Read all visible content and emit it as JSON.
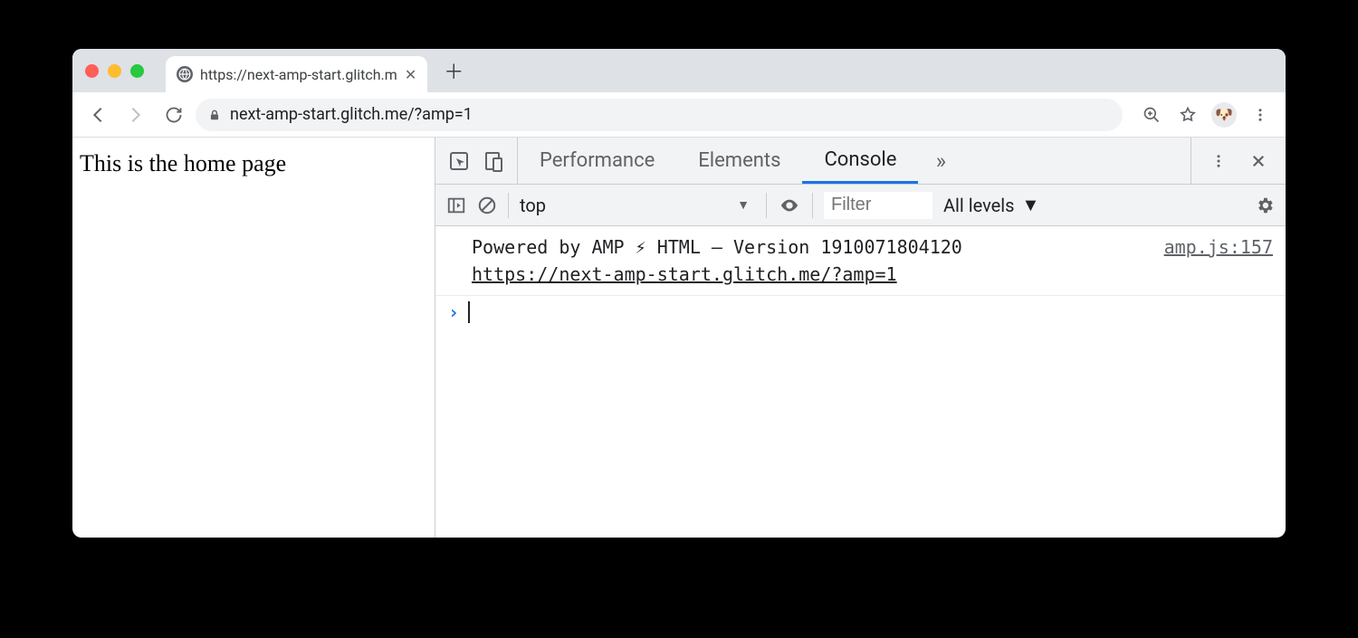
{
  "browser": {
    "tab_title": "https://next-amp-start.glitch.m",
    "url": "next-amp-start.glitch.me/?amp=1",
    "avatar_emoji": "🐶"
  },
  "page": {
    "body_text": "This is the home page"
  },
  "devtools": {
    "tabs": {
      "performance": "Performance",
      "elements": "Elements",
      "console": "Console"
    },
    "console_toolbar": {
      "context": "top",
      "filter_placeholder": "Filter",
      "levels_label": "All levels"
    },
    "log": {
      "message_line1": "Powered by AMP ⚡ HTML – Version 1910071804120",
      "message_url": "https://next-amp-start.glitch.me/?amp=1",
      "source": "amp.js:157"
    }
  }
}
